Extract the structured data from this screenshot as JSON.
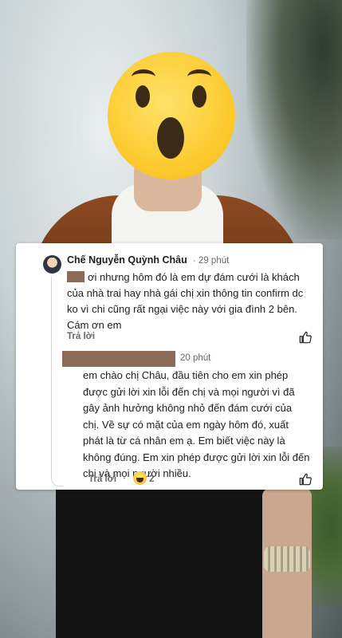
{
  "comment1": {
    "author": "Chế Nguyễn Quỳnh Châu",
    "time": "29 phút",
    "text": "ơi nhưng hôm đó là em dự đám cưới là khách của nhà trai hay nhà gái chị xin thông tin confirm dc ko vì chi cũng rất ngại việc này với gia đình 2 bên. Cám ơn em",
    "reply_label": "Trả lời"
  },
  "comment2": {
    "time": "20 phút",
    "text": "em chào chị Châu, đầu tiên cho em xin phép được gửi lời xin lỗi đến chị và mọi người vì đã gây ảnh hưởng không nhỏ đến đám cưới của chị. Về sự có mặt của em ngày hôm đó, xuất phát là từ cá nhân em ạ. Em biết việc này là không đúng. Em xin phép được gửi lời xin lỗi đến chị và mọi người nhiều.",
    "reply_label": "Trả lời",
    "reaction_count": "2"
  },
  "icons": {
    "overlay": "shocked-face-emoji",
    "like": "thumbs-up-icon",
    "reaction": "laughing-face-icon"
  }
}
